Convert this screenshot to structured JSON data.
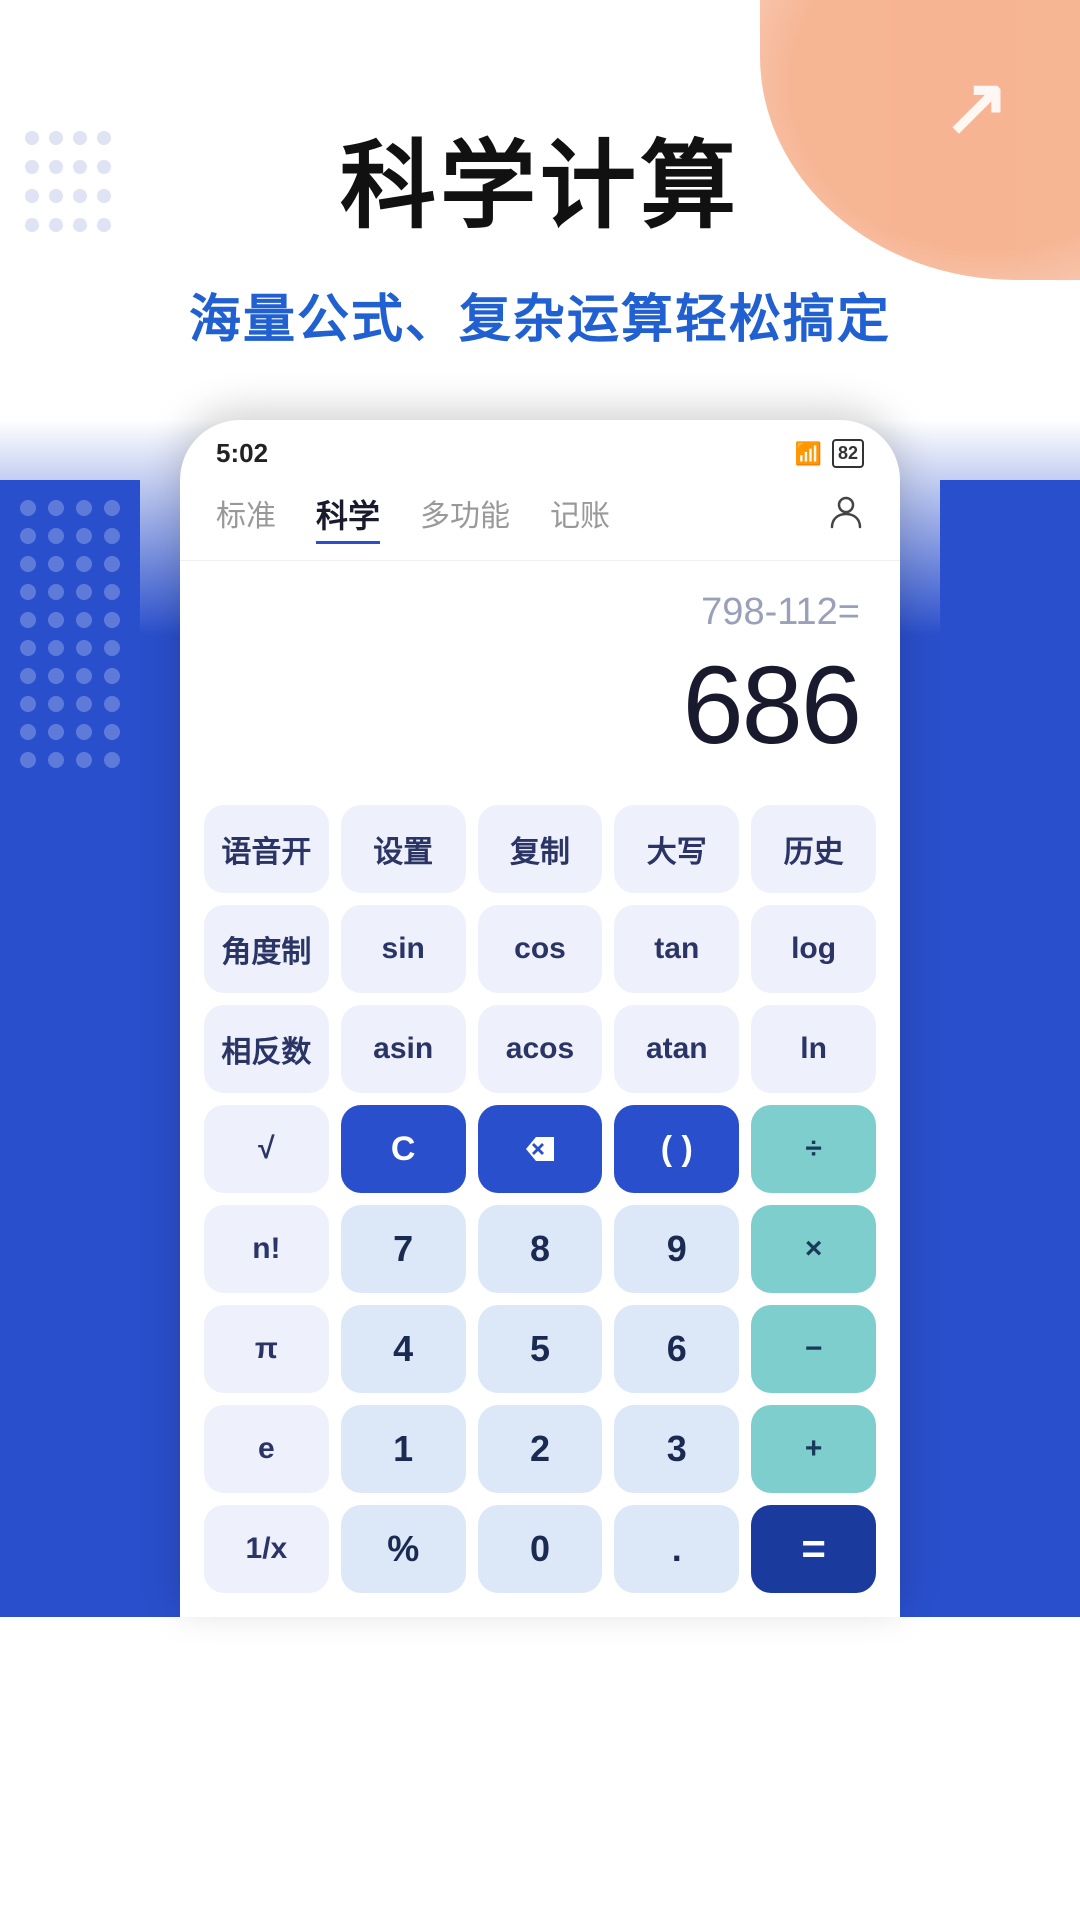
{
  "hero": {
    "title": "科学计算",
    "subtitle": "海量公式、复杂运算轻松搞定"
  },
  "status_bar": {
    "time": "5:02",
    "battery": "82"
  },
  "nav": {
    "tabs": [
      {
        "id": "standard",
        "label": "标准",
        "active": false
      },
      {
        "id": "science",
        "label": "科学",
        "active": true
      },
      {
        "id": "multi",
        "label": "多功能",
        "active": false
      },
      {
        "id": "account",
        "label": "记账",
        "active": false
      }
    ],
    "profile_icon": "👤"
  },
  "display": {
    "expression": "798-112=",
    "result": "686"
  },
  "keypad": {
    "rows": [
      [
        {
          "label": "语音开",
          "type": "light"
        },
        {
          "label": "设置",
          "type": "light"
        },
        {
          "label": "复制",
          "type": "light"
        },
        {
          "label": "大写",
          "type": "light"
        },
        {
          "label": "历史",
          "type": "light"
        }
      ],
      [
        {
          "label": "角度制",
          "type": "light"
        },
        {
          "label": "sin",
          "type": "light"
        },
        {
          "label": "cos",
          "type": "light"
        },
        {
          "label": "tan",
          "type": "light"
        },
        {
          "label": "log",
          "type": "light"
        }
      ],
      [
        {
          "label": "相反数",
          "type": "light"
        },
        {
          "label": "asin",
          "type": "light"
        },
        {
          "label": "acos",
          "type": "light"
        },
        {
          "label": "atan",
          "type": "light"
        },
        {
          "label": "ln",
          "type": "light"
        }
      ],
      [
        {
          "label": "√",
          "type": "light"
        },
        {
          "label": "C",
          "type": "dark-blue"
        },
        {
          "label": "⌫",
          "type": "dark-blue"
        },
        {
          "label": "( )",
          "type": "dark-blue"
        },
        {
          "label": "÷",
          "type": "teal"
        }
      ],
      [
        {
          "label": "n!",
          "type": "light"
        },
        {
          "label": "7",
          "type": "number"
        },
        {
          "label": "8",
          "type": "number"
        },
        {
          "label": "9",
          "type": "number"
        },
        {
          "label": "×",
          "type": "teal"
        }
      ],
      [
        {
          "label": "π",
          "type": "light"
        },
        {
          "label": "4",
          "type": "number"
        },
        {
          "label": "5",
          "type": "number"
        },
        {
          "label": "6",
          "type": "number"
        },
        {
          "label": "−",
          "type": "teal"
        }
      ],
      [
        {
          "label": "e",
          "type": "light"
        },
        {
          "label": "1",
          "type": "number"
        },
        {
          "label": "2",
          "type": "number"
        },
        {
          "label": "3",
          "type": "number"
        },
        {
          "label": "+",
          "type": "teal"
        }
      ],
      [
        {
          "label": "1/x",
          "type": "light"
        },
        {
          "label": "%",
          "type": "number"
        },
        {
          "label": "0",
          "type": "number"
        },
        {
          "label": ".",
          "type": "number"
        },
        {
          "label": "=",
          "type": "equals"
        }
      ]
    ]
  }
}
